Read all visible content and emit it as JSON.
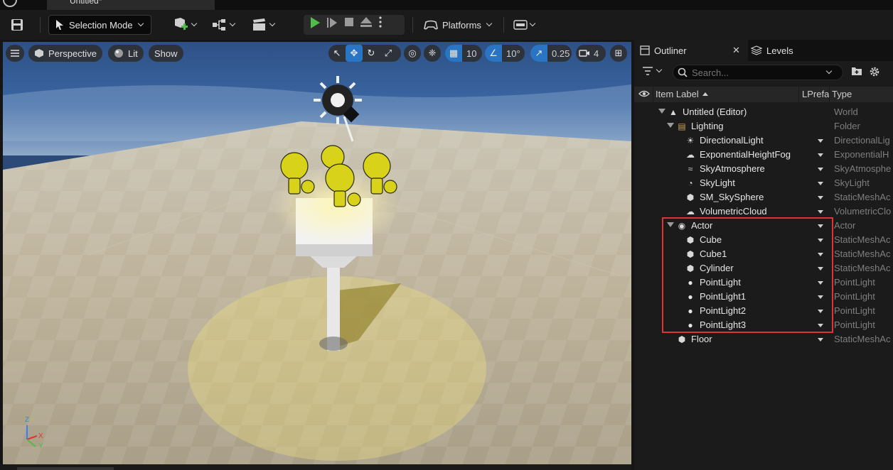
{
  "window": {
    "doc_tab_title": "Untitled*"
  },
  "toolbar": {
    "selection_mode_label": "Selection Mode",
    "platforms_label": "Platforms",
    "icons": [
      "save-icon",
      "add-actor-icon",
      "blueprint-icon",
      "cinematics-icon",
      "play-icon",
      "step-icon",
      "stop-icon",
      "eject-icon",
      "more-icon",
      "platforms-icon",
      "settings-icon"
    ]
  },
  "viewport": {
    "menu_icon": "hamburger-icon",
    "perspective_label": "Perspective",
    "lit_label": "Lit",
    "show_label": "Show",
    "grid_snap_value": "10",
    "rotation_snap_value": "10°",
    "scale_snap_value": "0.25",
    "camera_speed_value": "4",
    "axis_labels": {
      "x": "X",
      "y": "Y",
      "z": "Z"
    }
  },
  "outliner": {
    "tab_outliner": "Outliner",
    "tab_levels": "Levels",
    "search_placeholder": "Search...",
    "columns": {
      "item_label": "Item Label",
      "lprefab": "LPrefa",
      "type": "Type"
    },
    "rows": [
      {
        "label": "Untitled (Editor)",
        "type": "World",
        "icon": "world-icon",
        "indent": 0,
        "expander": true,
        "dropdown": false
      },
      {
        "label": "Lighting",
        "type": "Folder",
        "icon": "folder-icon",
        "indent": 1,
        "expander": true,
        "dropdown": false
      },
      {
        "label": "DirectionalLight",
        "type": "DirectionalLig",
        "icon": "sun-icon",
        "indent": 2,
        "expander": false,
        "dropdown": true
      },
      {
        "label": "ExponentialHeightFog",
        "type": "ExponentialH",
        "icon": "fog-icon",
        "indent": 2,
        "expander": false,
        "dropdown": true
      },
      {
        "label": "SkyAtmosphere",
        "type": "SkyAtmosphe",
        "icon": "sky-atmosphere-icon",
        "indent": 2,
        "expander": false,
        "dropdown": true
      },
      {
        "label": "SkyLight",
        "type": "SkyLight",
        "icon": "skylight-icon",
        "indent": 2,
        "expander": false,
        "dropdown": true
      },
      {
        "label": "SM_SkySphere",
        "type": "StaticMeshAc",
        "icon": "mesh-icon",
        "indent": 2,
        "expander": false,
        "dropdown": true
      },
      {
        "label": "VolumetricCloud",
        "type": "VolumetricClo",
        "icon": "cloud-icon",
        "indent": 2,
        "expander": false,
        "dropdown": true
      },
      {
        "label": "Actor",
        "type": "Actor",
        "icon": "actor-icon",
        "indent": 1,
        "expander": true,
        "dropdown": true
      },
      {
        "label": "Cube",
        "type": "StaticMeshAc",
        "icon": "mesh-icon",
        "indent": 2,
        "expander": false,
        "dropdown": true
      },
      {
        "label": "Cube1",
        "type": "StaticMeshAc",
        "icon": "mesh-icon",
        "indent": 2,
        "expander": false,
        "dropdown": true
      },
      {
        "label": "Cylinder",
        "type": "StaticMeshAc",
        "icon": "mesh-icon",
        "indent": 2,
        "expander": false,
        "dropdown": true
      },
      {
        "label": "PointLight",
        "type": "PointLight",
        "icon": "bulb-icon",
        "indent": 2,
        "expander": false,
        "dropdown": true
      },
      {
        "label": "PointLight1",
        "type": "PointLight",
        "icon": "bulb-icon",
        "indent": 2,
        "expander": false,
        "dropdown": true
      },
      {
        "label": "PointLight2",
        "type": "PointLight",
        "icon": "bulb-icon",
        "indent": 2,
        "expander": false,
        "dropdown": true
      },
      {
        "label": "PointLight3",
        "type": "PointLight",
        "icon": "bulb-icon",
        "indent": 2,
        "expander": false,
        "dropdown": true
      },
      {
        "label": "Floor",
        "type": "StaticMeshAc",
        "icon": "mesh-icon",
        "indent": 1,
        "expander": false,
        "dropdown": true
      }
    ]
  },
  "colors": {
    "accent_blue": "#2a74c4",
    "highlight_red": "#e03434",
    "play_green": "#4fbd47",
    "bulb_yellow": "#d8d21a"
  }
}
